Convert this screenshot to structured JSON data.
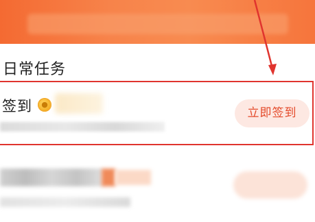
{
  "section": {
    "title": "日常任务"
  },
  "task": {
    "name": "签到",
    "button_label": "立即签到",
    "coin_icon": "coin-icon"
  },
  "colors": {
    "banner_orange": "#f6753c",
    "highlight_red": "#e0342e",
    "button_bg": "#fde8e2",
    "button_text": "#e44a2a"
  }
}
